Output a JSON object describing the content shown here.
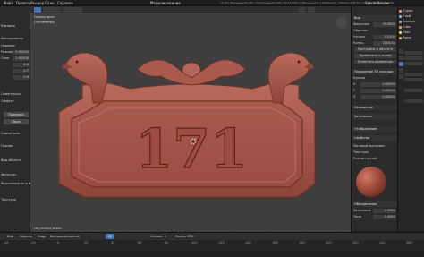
{
  "menu": [
    "Файл",
    "Правка",
    "Рендер",
    "Окно",
    "Справка"
  ],
  "workspace_tabs_label": "Моделирование",
  "stats": "v2.79 | Вершины:83,051 | Полигоны:83,040 | Тр:172,561 | Объекты:1/1 | Лампы:0/0 | Память:104.34 | Sculpt | Blender Render",
  "active_object_short": "Scene.Render",
  "viewport": {
    "view_label": "Сверху орто",
    "units_label": "Сантиметры",
    "footer": "(40) Untitled_Shader",
    "plaque_text": "171"
  },
  "left_panel": {
    "header": "Утилиты",
    "rows": [
      "Инструменты",
      "Нормаль",
      "Размер",
      "Сила",
      "Ориентация",
      "Оффсет",
      "Симметрия",
      "Прочее",
      "Вид объекта",
      "Фильтры",
      "Текстура"
    ],
    "values": [
      "0.00000",
      "1.00000",
      "4.0",
      "0.7",
      "0.0"
    ],
    "buttons": [
      "Привязка",
      "Сброс"
    ],
    "note": "Выделение не в N"
  },
  "right_panel": {
    "header": "Вид",
    "rows": [
      "Фокусное",
      "Обрезка:",
      "Начало",
      "Конец",
      "Положение 3D курсора",
      "Курсор",
      "X",
      "Y",
      "Z",
      "Освещение",
      "Затенение",
      "Отображение",
      "Свойства",
      "Матовый материал",
      "Текстура",
      "Затенение",
      "Реалистичный",
      "Объединение",
      "Затенение",
      "Тени"
    ],
    "values": [
      "35.0000",
      "0.0100",
      "1000.00",
      "0.00000",
      "0.00000",
      "0.00000",
      "0.1000",
      "0.4000"
    ],
    "buttons": [
      "Настройка в объекте",
      "Применить к сцене",
      "Отменить изменения"
    ]
  },
  "outliner": {
    "items": [
      "Сцена",
      "Слой",
      "Камера",
      "Cube",
      "Свет",
      "Plane"
    ]
  },
  "timeline": {
    "items": [
      "Вид",
      "Маркер",
      "Кадр",
      "Воспроизведение"
    ],
    "start": "Начало: 1",
    "end": "Конец: 250",
    "current_frame": "20",
    "ticks": [
      "-40",
      "-20",
      "0",
      "20",
      "40",
      "60",
      "80",
      "100",
      "120",
      "140",
      "160",
      "180",
      "200",
      "220",
      "240",
      "260"
    ]
  },
  "colors": {
    "accent": "#4772b3",
    "clay": "#a55448",
    "viewport_bg": "#3e3e3e",
    "panel_bg": "#2b2b2b"
  }
}
